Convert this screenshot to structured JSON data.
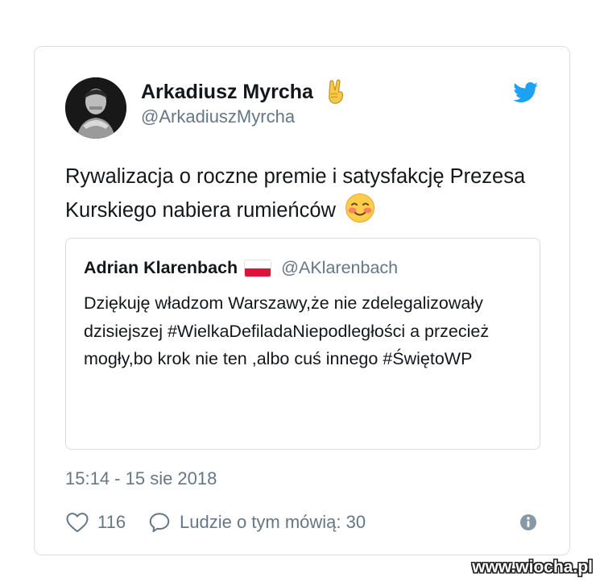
{
  "tweet": {
    "author": {
      "display_name": "Arkadiusz Myrcha",
      "handle": "@ArkadiuszMyrcha",
      "name_emoji": "victory-hand-icon"
    },
    "text": "Rywalizacja o roczne premie i satysfakcję Prezesa Kurskiego nabiera rumieńców",
    "text_emoji": "smiling-blushing-face-icon",
    "quoted": {
      "display_name": "Adrian Klarenbach",
      "flag": "poland-flag-icon",
      "handle": "@AKlarenbach",
      "text": "Dziękuję władzom Warszawy,że nie zdelegalizowały dzisiejszej #WielkaDefiladaNiepodległości a przecież mogły,bo krok nie ten ,albo cuś innego #ŚwiętoWP"
    },
    "timestamp": "15:14 - 15 sie 2018",
    "likes": "116",
    "replies_label": "Ludzie o tym mówią: 30"
  },
  "watermark": "www.wiocha.pl",
  "colors": {
    "twitter_blue": "#1da1f2",
    "secondary_text": "#657786",
    "border": "#d9dee2"
  }
}
